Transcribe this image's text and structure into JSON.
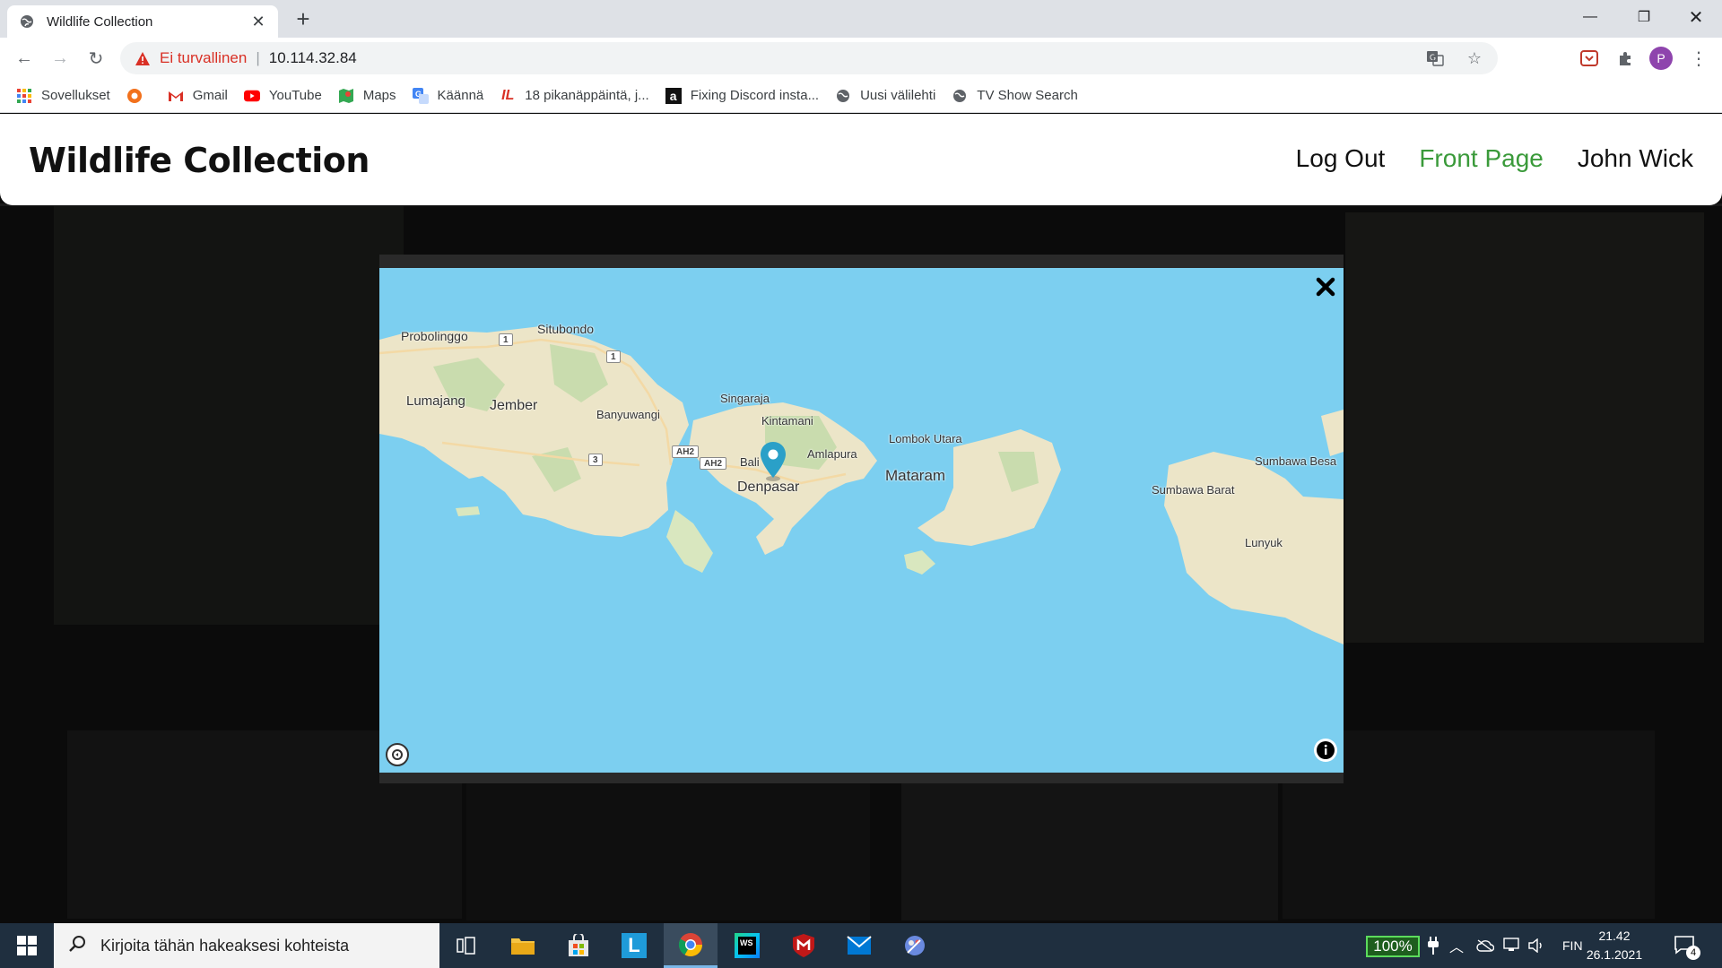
{
  "browser": {
    "tab_title": "Wildlife Collection",
    "security_label": "Ei turvallinen",
    "url": "10.114.32.84",
    "profile_initial": "P",
    "bookmarks": [
      {
        "label": "Sovellukset",
        "icon": "apps-grid-icon"
      },
      {
        "label": "",
        "icon": "ring-icon"
      },
      {
        "label": "Gmail",
        "icon": "gmail-icon"
      },
      {
        "label": "YouTube",
        "icon": "youtube-icon"
      },
      {
        "label": "Maps",
        "icon": "maps-icon"
      },
      {
        "label": "Käännä",
        "icon": "translate-icon"
      },
      {
        "label": "18 pikanäppäintä, j...",
        "icon": "il-icon"
      },
      {
        "label": "Fixing Discord insta...",
        "icon": "a-icon"
      },
      {
        "label": "Uusi välilehti",
        "icon": "globe-icon"
      },
      {
        "label": "TV Show Search",
        "icon": "globe-icon"
      }
    ]
  },
  "site": {
    "title": "Wildlife Collection",
    "nav": [
      {
        "label": "Log Out",
        "active": false
      },
      {
        "label": "Front Page",
        "active": true
      },
      {
        "label": "John Wick",
        "active": false
      }
    ]
  },
  "map": {
    "marker_location": "Bali",
    "labels": [
      {
        "text": "Probolinggo"
      },
      {
        "text": "Situbondo"
      },
      {
        "text": "Lumajang"
      },
      {
        "text": "Jember"
      },
      {
        "text": "Banyuwangi"
      },
      {
        "text": "Singaraja"
      },
      {
        "text": "Kintamani"
      },
      {
        "text": "Bali"
      },
      {
        "text": "Amlapura"
      },
      {
        "text": "Denpasar"
      },
      {
        "text": "Lombok Utara"
      },
      {
        "text": "Mataram"
      },
      {
        "text": "Sumbawa Besa"
      },
      {
        "text": "Sumbawa Barat"
      },
      {
        "text": "Lunyuk"
      }
    ],
    "road_shields": [
      "1",
      "1",
      "3",
      "AH2",
      "AH2"
    ]
  },
  "taskbar": {
    "search_placeholder": "Kirjoita tähän hakeaksesi kohteista",
    "battery": "100%",
    "language": "FIN",
    "time": "21.42",
    "date": "26.1.2021",
    "notifications": "4"
  }
}
